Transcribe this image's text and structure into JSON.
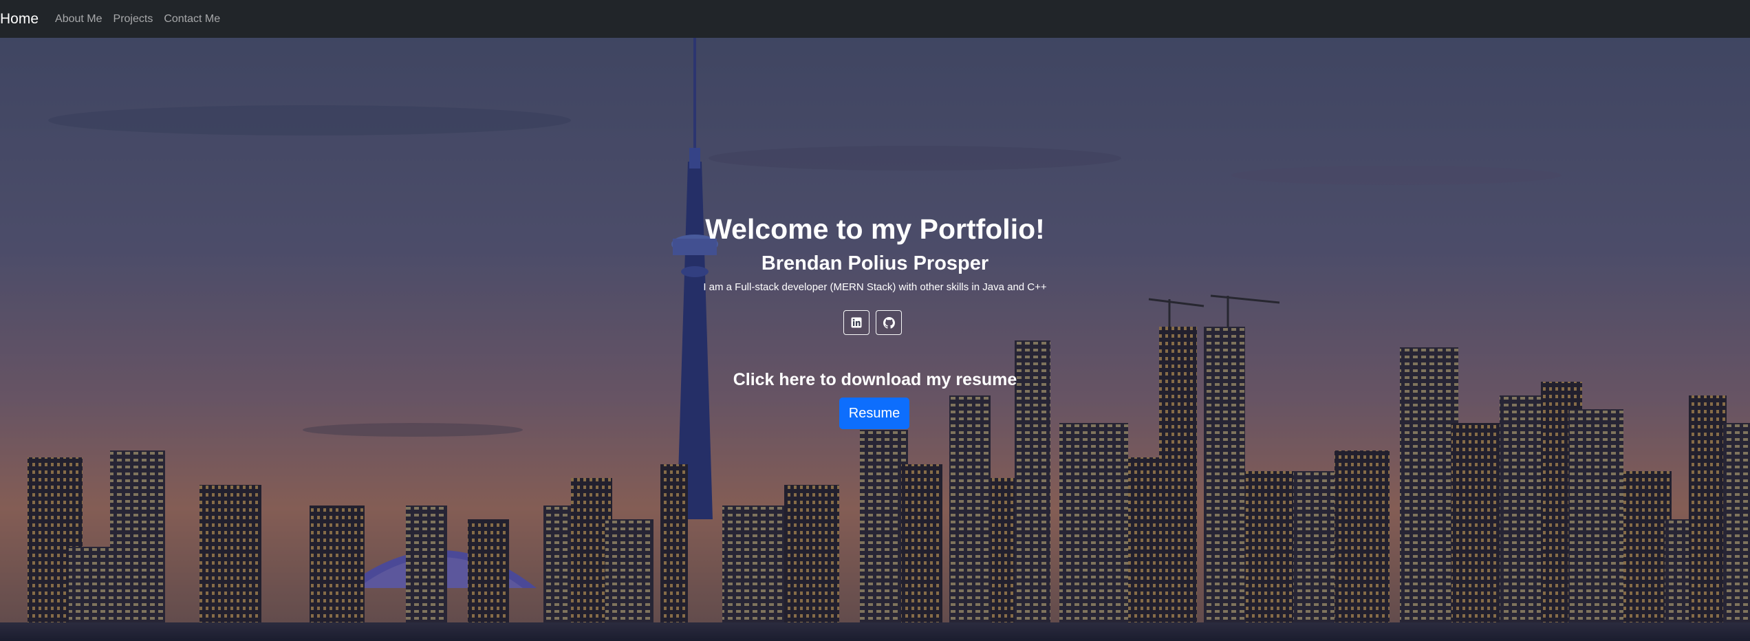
{
  "navbar": {
    "brand": "Home",
    "links": [
      "About Me",
      "Projects",
      "Contact Me"
    ]
  },
  "hero": {
    "title": "Welcome to my Portfolio!",
    "name": "Brendan Polius Prosper",
    "tagline": "I am a Full-stack developer (MERN Stack) with other skills in Java and C++",
    "socials": [
      {
        "icon": "linkedin-icon"
      },
      {
        "icon": "github-icon"
      }
    ],
    "resume_prompt": "Click here to download my resume",
    "resume_button": "Resume"
  },
  "colors": {
    "navbar_bg": "#212529",
    "primary": "#0d6efd",
    "text": "#ffffff",
    "nav_link": "rgba(255,255,255,0.6)"
  }
}
